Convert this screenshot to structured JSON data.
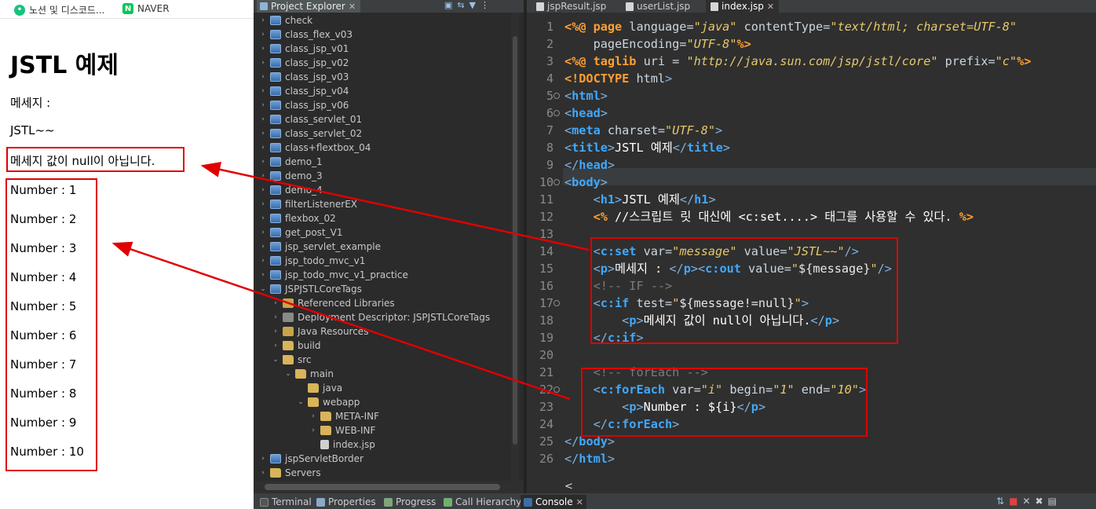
{
  "browser": {
    "bookmarks": [
      {
        "label": "노션 및 디스코드...",
        "icon": "chat-bubble-icon"
      },
      {
        "label": "NAVER",
        "icon": "naver-n-icon",
        "icon_text": "N"
      }
    ],
    "page": {
      "heading": "JSTL 예제",
      "message_label": "메세지 :",
      "message_value": "JSTL~~",
      "not_null_text": "메세지 값이 null이 아닙니다.",
      "numbers": [
        "Number : 1",
        "Number : 2",
        "Number : 3",
        "Number : 4",
        "Number : 5",
        "Number : 6",
        "Number : 7",
        "Number : 8",
        "Number : 9",
        "Number : 10"
      ]
    }
  },
  "explorer": {
    "tab_label": "Project Explorer",
    "close_glyph": "✕",
    "items": [
      {
        "label": "check",
        "type": "project",
        "toggle": "›"
      },
      {
        "label": "class_flex_v03",
        "type": "project",
        "toggle": "›"
      },
      {
        "label": "class_jsp_v01",
        "type": "project",
        "toggle": "›"
      },
      {
        "label": "class_jsp_v02",
        "type": "project",
        "toggle": "›"
      },
      {
        "label": "class_jsp_v03",
        "type": "project",
        "toggle": "›"
      },
      {
        "label": "class_jsp_v04",
        "type": "project",
        "toggle": "›"
      },
      {
        "label": "class_jsp_v06",
        "type": "project",
        "toggle": "›"
      },
      {
        "label": "class_servlet_01",
        "type": "project",
        "toggle": "›"
      },
      {
        "label": "class_servlet_02",
        "type": "project",
        "toggle": "›"
      },
      {
        "label": "class+flextbox_04",
        "type": "project",
        "toggle": "›"
      },
      {
        "label": "demo_1",
        "type": "project",
        "toggle": "›"
      },
      {
        "label": "demo_3",
        "type": "project",
        "toggle": "›"
      },
      {
        "label": "demo_4",
        "type": "project",
        "toggle": "›"
      },
      {
        "label": "filterListenerEX",
        "type": "project",
        "toggle": "›"
      },
      {
        "label": "flexbox_02",
        "type": "project",
        "toggle": "›"
      },
      {
        "label": "get_post_V1",
        "type": "project",
        "toggle": "›"
      },
      {
        "label": "jsp_servlet_example",
        "type": "project",
        "toggle": "›"
      },
      {
        "label": "jsp_todo_mvc_v1",
        "type": "project",
        "toggle": "›"
      },
      {
        "label": "jsp_todo_mvc_v1_practice",
        "type": "project",
        "toggle": "›"
      },
      {
        "label": "JSPJSTLCoreTags",
        "type": "project",
        "toggle": "⌄"
      },
      {
        "label": "Referenced Libraries",
        "type": "lib",
        "toggle": "›"
      },
      {
        "label": "Deployment Descriptor: JSPJSTLCoreTags",
        "type": "dd",
        "toggle": "›"
      },
      {
        "label": "Java Resources",
        "type": "lib",
        "toggle": "›"
      },
      {
        "label": "build",
        "type": "folder",
        "toggle": "›"
      },
      {
        "label": "src",
        "type": "folder",
        "toggle": "⌄"
      },
      {
        "label": "main",
        "type": "folder",
        "toggle": "⌄"
      },
      {
        "label": "java",
        "type": "folder",
        "toggle": ""
      },
      {
        "label": "webapp",
        "type": "folder",
        "toggle": "⌄"
      },
      {
        "label": "META-INF",
        "type": "folder",
        "toggle": "›"
      },
      {
        "label": "WEB-INF",
        "type": "folder",
        "toggle": "›"
      },
      {
        "label": "index.jsp",
        "type": "file",
        "toggle": ""
      },
      {
        "label": "jspServletBorder",
        "type": "project",
        "toggle": "›"
      },
      {
        "label": "Servers",
        "type": "folder",
        "toggle": "›"
      }
    ]
  },
  "editor": {
    "tabs": [
      {
        "label": "jspResult.jsp"
      },
      {
        "label": "userList.jsp"
      },
      {
        "label": "index.jsp",
        "active": true,
        "close": "✕"
      }
    ],
    "lines": [
      {
        "n": "1",
        "fold": false,
        "tokens": [
          [
            "jsp",
            "<%@ page"
          ],
          [
            "attr",
            " language="
          ],
          [
            "str",
            "\"java\""
          ],
          [
            "attr",
            " contentType="
          ],
          [
            "str",
            "\"text/html; charset=UTF-8\""
          ]
        ]
      },
      {
        "n": "2",
        "fold": false,
        "tokens": [
          [
            "attr",
            "    pageEncoding="
          ],
          [
            "str",
            "\"UTF-8\""
          ],
          [
            "jsp",
            "%>"
          ]
        ]
      },
      {
        "n": "3",
        "fold": false,
        "tokens": [
          [
            "jsp",
            "<%@ taglib"
          ],
          [
            "attr",
            " uri = "
          ],
          [
            "str",
            "\"http://java.sun.com/jsp/jstl/core\""
          ],
          [
            "attr",
            " prefix="
          ],
          [
            "str",
            "\"c\""
          ],
          [
            "jsp",
            "%>"
          ]
        ]
      },
      {
        "n": "4",
        "fold": false,
        "tokens": [
          [
            "doc",
            "<!DOCTYPE"
          ],
          [
            "attr",
            " html"
          ],
          [
            "brk",
            ">"
          ]
        ]
      },
      {
        "n": "5",
        "fold": true,
        "tokens": [
          [
            "brk",
            "<"
          ],
          [
            "tag",
            "html"
          ],
          [
            "brk",
            ">"
          ]
        ]
      },
      {
        "n": "6",
        "fold": true,
        "tokens": [
          [
            "brk",
            "<"
          ],
          [
            "tag",
            "head"
          ],
          [
            "brk",
            ">"
          ]
        ]
      },
      {
        "n": "7",
        "fold": false,
        "tokens": [
          [
            "brk",
            "<"
          ],
          [
            "tag",
            "meta"
          ],
          [
            "attr",
            " charset="
          ],
          [
            "str",
            "\"UTF-8\""
          ],
          [
            "brk",
            ">"
          ]
        ]
      },
      {
        "n": "8",
        "fold": false,
        "tokens": [
          [
            "brk",
            "<"
          ],
          [
            "tag",
            "title"
          ],
          [
            "brk",
            ">"
          ],
          [
            "txt",
            "JSTL 예제"
          ],
          [
            "brk",
            "</"
          ],
          [
            "tag",
            "title"
          ],
          [
            "brk",
            ">"
          ]
        ]
      },
      {
        "n": "9",
        "fold": false,
        "tokens": [
          [
            "brk",
            "</"
          ],
          [
            "tag",
            "head"
          ],
          [
            "brk",
            ">"
          ]
        ]
      },
      {
        "n": "10",
        "fold": true,
        "tokens": [
          [
            "brk",
            "<"
          ],
          [
            "tag",
            "body"
          ],
          [
            "brk",
            ">"
          ]
        ]
      },
      {
        "n": "11",
        "fold": false,
        "tokens": [
          [
            "txt",
            "    "
          ],
          [
            "brk",
            "<"
          ],
          [
            "tag",
            "h1"
          ],
          [
            "brk",
            ">"
          ],
          [
            "txt",
            "JSTL 예제"
          ],
          [
            "brk",
            "</"
          ],
          [
            "tag",
            "h1"
          ],
          [
            "brk",
            ">"
          ]
        ]
      },
      {
        "n": "12",
        "fold": false,
        "tokens": [
          [
            "txt",
            "    "
          ],
          [
            "jsp",
            "<%"
          ],
          [
            "txt",
            " //스크립트 릿 대신에 <c:set....> 태그를 사용할 수 있다. "
          ],
          [
            "jsp",
            "%>"
          ]
        ]
      },
      {
        "n": "13",
        "fold": false,
        "tokens": []
      },
      {
        "n": "14",
        "fold": false,
        "tokens": [
          [
            "txt",
            "    "
          ],
          [
            "brk",
            "<"
          ],
          [
            "tag",
            "c:set"
          ],
          [
            "attr",
            " var="
          ],
          [
            "str",
            "\"message\""
          ],
          [
            "attr",
            " value="
          ],
          [
            "str",
            "\"JSTL~~\""
          ],
          [
            "brk",
            "/>"
          ]
        ]
      },
      {
        "n": "15",
        "fold": false,
        "tokens": [
          [
            "txt",
            "    "
          ],
          [
            "brk",
            "<"
          ],
          [
            "tag",
            "p"
          ],
          [
            "brk",
            ">"
          ],
          [
            "txt",
            "메세지 : "
          ],
          [
            "brk",
            "</"
          ],
          [
            "tag",
            "p"
          ],
          [
            "brk",
            "><"
          ],
          [
            "tag",
            "c:out"
          ],
          [
            "attr",
            " value="
          ],
          [
            "str",
            "\""
          ],
          [
            "el",
            "${message}"
          ],
          [
            "str",
            "\""
          ],
          [
            "brk",
            "/>"
          ]
        ]
      },
      {
        "n": "16",
        "fold": false,
        "tokens": [
          [
            "txt",
            "    "
          ],
          [
            "cmt",
            "<!-- IF -->"
          ]
        ]
      },
      {
        "n": "17",
        "fold": true,
        "tokens": [
          [
            "txt",
            "    "
          ],
          [
            "brk",
            "<"
          ],
          [
            "tag",
            "c:if"
          ],
          [
            "attr",
            " test="
          ],
          [
            "str",
            "\""
          ],
          [
            "el",
            "${message!=null}"
          ],
          [
            "str",
            "\""
          ],
          [
            "brk",
            ">"
          ]
        ]
      },
      {
        "n": "18",
        "fold": false,
        "tokens": [
          [
            "txt",
            "        "
          ],
          [
            "brk",
            "<"
          ],
          [
            "tag",
            "p"
          ],
          [
            "brk",
            ">"
          ],
          [
            "txt",
            "메세지 값이 null이 아닙니다."
          ],
          [
            "brk",
            "</"
          ],
          [
            "tag",
            "p"
          ],
          [
            "brk",
            ">"
          ]
        ]
      },
      {
        "n": "19",
        "fold": false,
        "tokens": [
          [
            "txt",
            "    "
          ],
          [
            "brk",
            "</"
          ],
          [
            "tag",
            "c:if"
          ],
          [
            "brk",
            ">"
          ]
        ]
      },
      {
        "n": "20",
        "fold": false,
        "tokens": []
      },
      {
        "n": "21",
        "fold": false,
        "tokens": [
          [
            "txt",
            "    "
          ],
          [
            "cmt",
            "<!-- forEach -->"
          ]
        ]
      },
      {
        "n": "22",
        "fold": true,
        "tokens": [
          [
            "txt",
            "    "
          ],
          [
            "brk",
            "<"
          ],
          [
            "tag",
            "c:forEach"
          ],
          [
            "attr",
            " var="
          ],
          [
            "str",
            "\"i\""
          ],
          [
            "attr",
            " begin="
          ],
          [
            "str",
            "\"1\""
          ],
          [
            "attr",
            " end="
          ],
          [
            "str",
            "\"10\""
          ],
          [
            "brk",
            ">"
          ]
        ]
      },
      {
        "n": "23",
        "fold": false,
        "tokens": [
          [
            "txt",
            "        "
          ],
          [
            "brk",
            "<"
          ],
          [
            "tag",
            "p"
          ],
          [
            "brk",
            ">"
          ],
          [
            "txt",
            "Number : ${i}"
          ],
          [
            "brk",
            "</"
          ],
          [
            "tag",
            "p"
          ],
          [
            "brk",
            ">"
          ]
        ]
      },
      {
        "n": "24",
        "fold": false,
        "tokens": [
          [
            "txt",
            "    "
          ],
          [
            "brk",
            "</"
          ],
          [
            "tag",
            "c:forEach"
          ],
          [
            "brk",
            ">"
          ]
        ]
      },
      {
        "n": "25",
        "fold": false,
        "tokens": [
          [
            "brk",
            "</"
          ],
          [
            "tag",
            "body"
          ],
          [
            "brk",
            ">"
          ]
        ]
      },
      {
        "n": "26",
        "fold": false,
        "tokens": [
          [
            "brk",
            "</"
          ],
          [
            "tag",
            "html"
          ],
          [
            "brk",
            ">"
          ]
        ]
      }
    ],
    "scroll_left_glyph": "<"
  },
  "bottom_panel": {
    "tabs": [
      {
        "label": "Terminal",
        "icon": "terminal-icon"
      },
      {
        "label": "Properties",
        "icon": "properties-icon"
      },
      {
        "label": "Progress",
        "icon": "progress-icon"
      },
      {
        "label": "Call Hierarchy",
        "icon": "call-hierarchy-icon"
      },
      {
        "label": "Console",
        "icon": "console-icon",
        "active": true,
        "close": "✕"
      }
    ]
  },
  "colors": {
    "annotation_red": "#e00000",
    "ide_background": "#2f2f2f",
    "tag_blue": "#3fa9ff",
    "jsp_orange": "#ff9f30",
    "string_yellow": "#e6c86a"
  }
}
